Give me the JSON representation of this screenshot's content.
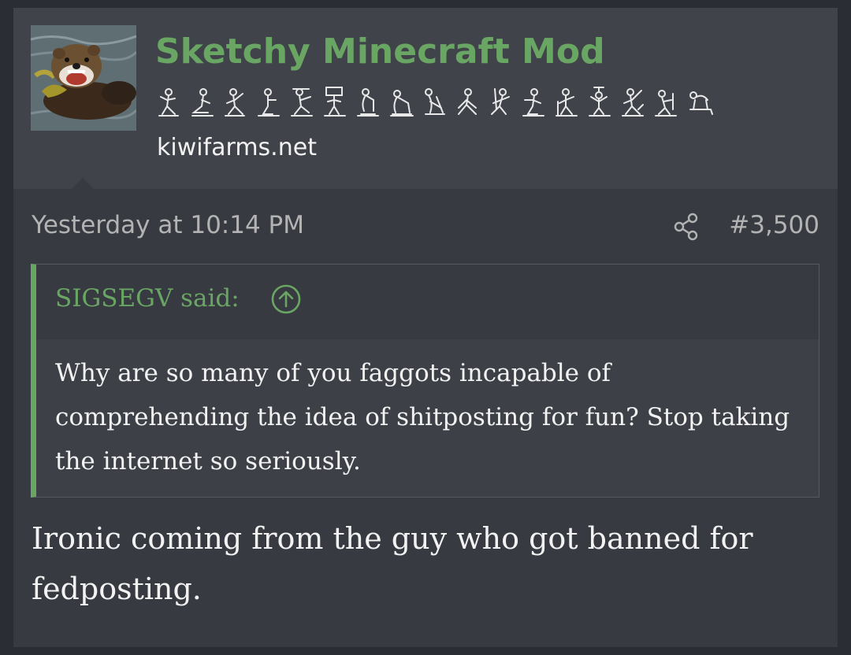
{
  "post": {
    "username": "Sketchy Minecraft Mod",
    "user_title_glyphs": "𓀀𓀁𓀂𓀃𓀄𓀅𓀆𓀇𓀈𓀉𓀊𓀋𓀌𓀍𓀎𓀏𓀐𓀑",
    "site": "kiwifarms.net",
    "timestamp": "Yesterday at 10:14 PM",
    "post_number": "#3,500",
    "share_icon": "share-icon",
    "quote": {
      "author_label": "SIGSEGV said:",
      "jump_icon": "arrow-up-circle-icon",
      "body": "Why are so many of you faggots incapable of comprehending the idea of shitposting for fun? Stop taking the internet so seriously."
    },
    "reply": "Ironic coming from the guy who got banned for fedposting.",
    "colors": {
      "accent": "#6aa663",
      "page_background": "#2a2d33",
      "card_background": "#373a41",
      "header_background": "#40434a",
      "text": "#f2f2f2",
      "muted_text": "#b3b3b3"
    }
  }
}
